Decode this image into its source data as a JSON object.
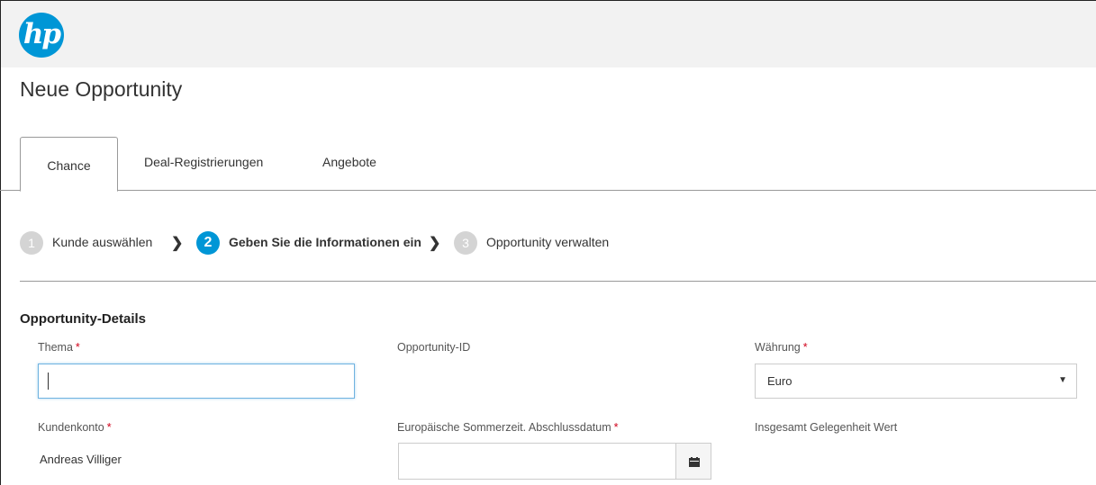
{
  "brand": {
    "logo_text": "hp",
    "logo_color": "#0096d6"
  },
  "page": {
    "title": "Neue Opportunity"
  },
  "tabs": [
    {
      "label": "Chance",
      "active": true
    },
    {
      "label": "Deal-Registrierungen",
      "active": false
    },
    {
      "label": "Angebote",
      "active": false
    }
  ],
  "steps": [
    {
      "number": "1",
      "label": "Kunde auswählen",
      "active": false
    },
    {
      "number": "2",
      "label": "Geben Sie die Informationen ein",
      "active": true
    },
    {
      "number": "3",
      "label": "Opportunity verwalten",
      "active": false
    }
  ],
  "section": {
    "title": "Opportunity-Details"
  },
  "fields": {
    "thema": {
      "label": "Thema",
      "required": "*",
      "value": ""
    },
    "opportunity_id": {
      "label": "Opportunity-ID"
    },
    "waehrung": {
      "label": "Währung",
      "required": "*",
      "value": "Euro"
    },
    "kundenkonto": {
      "label": "Kundenkonto",
      "required": "*",
      "value": "Andreas Villiger"
    },
    "abschlussdatum": {
      "label": "Europäische Sommerzeit. Abschlussdatum",
      "required": "*",
      "value": ""
    },
    "gesamtwert": {
      "label": "Insgesamt Gelegenheit Wert"
    }
  },
  "icons": {
    "step_separator": "chevron-right-icon",
    "date_picker": "calendar-icon",
    "select_arrow": "caret-down-icon"
  },
  "colors": {
    "accent": "#0096d6",
    "required": "#d0021b",
    "inactive_step": "#d4d4d4"
  }
}
